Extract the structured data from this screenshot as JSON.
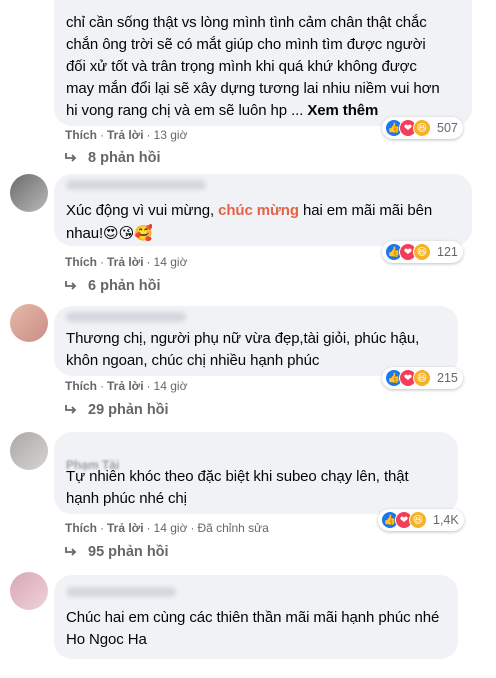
{
  "comments": [
    {
      "name_visible": "",
      "text_lines": [
        "chỉ cần sống thật vs lòng mình tình cảm chân thật chắc",
        "chắn ông trời sẽ có mắt giúp cho mình tìm được người",
        "đối xử tốt và trân trọng mình khi quá khứ không được",
        "may mắn đổi lại sẽ xây dựng tương lai nhiu niềm vui hơn",
        "hi vong rang chị và em sẽ luôn hp ..."
      ],
      "see_more": "Xem thêm",
      "like_label": "Thích",
      "reply_label": "Trả lời",
      "time": "13 giờ",
      "edited": "",
      "reaction_count": "507",
      "replies_label": "8 phản hồi"
    },
    {
      "name_visible": "",
      "text_before": "Xúc động vì vui mừng, ",
      "text_highlight": "chúc mừng",
      "text_after": " hai em mãi mãi bên",
      "text_line2": "nhau!",
      "emojis": "😍😘🥰",
      "like_label": "Thích",
      "reply_label": "Trả lời",
      "time": "14 giờ",
      "reaction_count": "121",
      "replies_label": "6 phản hồi"
    },
    {
      "name_visible": "",
      "text_lines": [
        "Thương chị, người phụ nữ vừa đẹp,tài giỏi, phúc hậu,",
        "khôn ngoan, chúc chị nhiều hạnh phúc"
      ],
      "like_label": "Thích",
      "reply_label": "Trả lời",
      "time": "14 giờ",
      "reaction_count": "215",
      "replies_label": "29 phản hồi"
    },
    {
      "name_visible": "Phạm Tài",
      "text_lines": [
        "Tự nhiên khóc theo đặc biệt khi subeo chạy lên, thật",
        "hạnh phúc nhé chị"
      ],
      "like_label": "Thích",
      "reply_label": "Trả lời",
      "time": "14 giờ",
      "edited": "Đã chỉnh sửa",
      "reaction_count": "1,4K",
      "replies_label": "95 phản hồi"
    },
    {
      "name_visible": "",
      "text_lines": [
        "Chúc hai em cùng các thiên thần mãi mãi hạnh phúc nhé",
        "Ho Ngoc Ha"
      ]
    }
  ],
  "colors": {
    "bubble": "#f0f2f5",
    "highlight": "#e4634a",
    "muted": "#65676b",
    "like": "#1877f2",
    "love": "#f33e58",
    "haha": "#f7b125"
  },
  "icons": [
    "like-icon",
    "love-icon",
    "haha-icon",
    "reply-arrow-icon"
  ]
}
